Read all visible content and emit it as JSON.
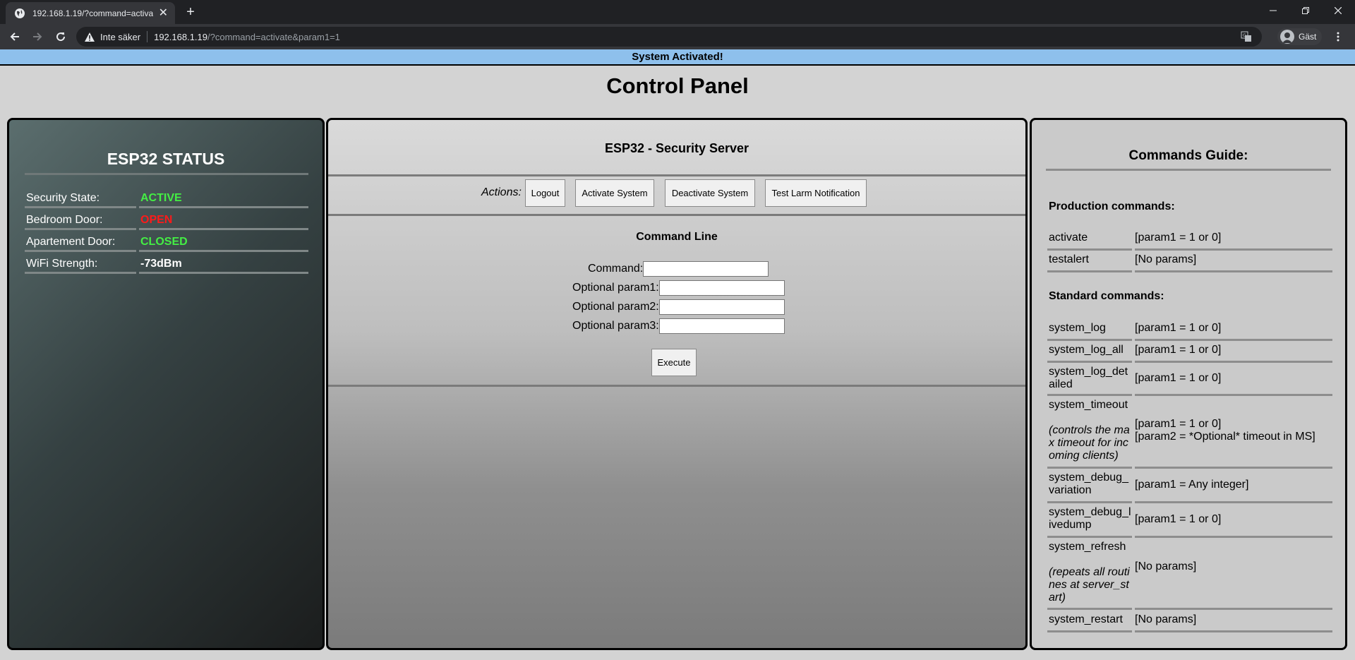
{
  "browser": {
    "tab_title": "192.168.1.19/?command=activate&param1=1",
    "address_security_label": "Inte säker",
    "address_host": "192.168.1.19",
    "address_path": "/?command=activate&param1=1",
    "profile_label": "Gäst"
  },
  "banner": {
    "text": "System Activated!"
  },
  "page": {
    "title": "Control Panel"
  },
  "status_panel": {
    "title": "ESP32 STATUS",
    "rows": [
      {
        "label": "Security State:",
        "value": "ACTIVE",
        "color": "#44ee44"
      },
      {
        "label": "Bedroom Door:",
        "value": "OPEN",
        "color": "#ff1a1a"
      },
      {
        "label": "Apartement Door:",
        "value": "CLOSED",
        "color": "#44ee44"
      },
      {
        "label": "WiFi Strength:",
        "value": "-73dBm",
        "color": "#ffffff"
      }
    ]
  },
  "server_panel": {
    "title": "ESP32 - Security Server",
    "actions_label": "Actions:",
    "buttons": {
      "logout": "Logout",
      "activate": "Activate System",
      "deactivate": "Deactivate System",
      "test_larm": "Test Larm Notification"
    },
    "command_line": {
      "title": "Command Line",
      "command_label": "Command:",
      "param1_label": "Optional param1:",
      "param2_label": "Optional param2:",
      "param3_label": "Optional param3:",
      "execute_label": "Execute"
    }
  },
  "guide_panel": {
    "title": "Commands Guide:",
    "production_heading": "Production commands:",
    "production": [
      {
        "command": "activate",
        "params": "[param1 = 1 or 0]"
      },
      {
        "command": "testalert",
        "params": "[No params]"
      }
    ],
    "standard_heading": "Standard commands:",
    "standard": [
      {
        "command": "system_log",
        "params": "[param1 = 1 or 0]"
      },
      {
        "command": "system_log_all",
        "params": "[param1 = 1 or 0]"
      },
      {
        "command": "system_log_detailed",
        "params": "[param1 = 1 or 0]"
      },
      {
        "command": "system_timeout",
        "note": "(controls the max timeout for incoming clients)",
        "params_line1": "[param1 = 1 or 0]",
        "params_line2": "[param2 = *Optional* timeout in MS]"
      },
      {
        "command": "system_debug_variation",
        "params": "[param1 = Any integer]"
      },
      {
        "command": "system_debug_livedump",
        "params": "[param1 = 1 or 0]"
      },
      {
        "command": "system_refresh",
        "note": "(repeats all routines at server_start)",
        "params": "[No params]"
      },
      {
        "command": "system_restart",
        "params": "[No params]"
      }
    ]
  }
}
